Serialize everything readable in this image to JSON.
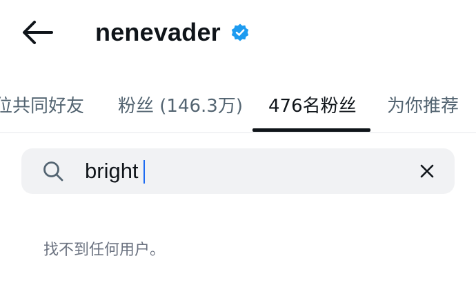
{
  "header": {
    "username": "nenevader",
    "back_icon": "arrow-left-icon",
    "verified_icon": "verified-badge-icon",
    "verified_color": "#1d9bf0"
  },
  "tabs": [
    {
      "label": "位共同好友",
      "active": false
    },
    {
      "label": "粉丝 (146.3万)",
      "active": false
    },
    {
      "label": "476名粉丝",
      "active": true
    },
    {
      "label": "为你推荐",
      "active": false
    }
  ],
  "search": {
    "value": "bright",
    "search_icon": "search-icon",
    "clear_icon": "close-icon",
    "caret_color": "#1d6bf2"
  },
  "empty_state": {
    "message": "找不到任何用户。"
  }
}
